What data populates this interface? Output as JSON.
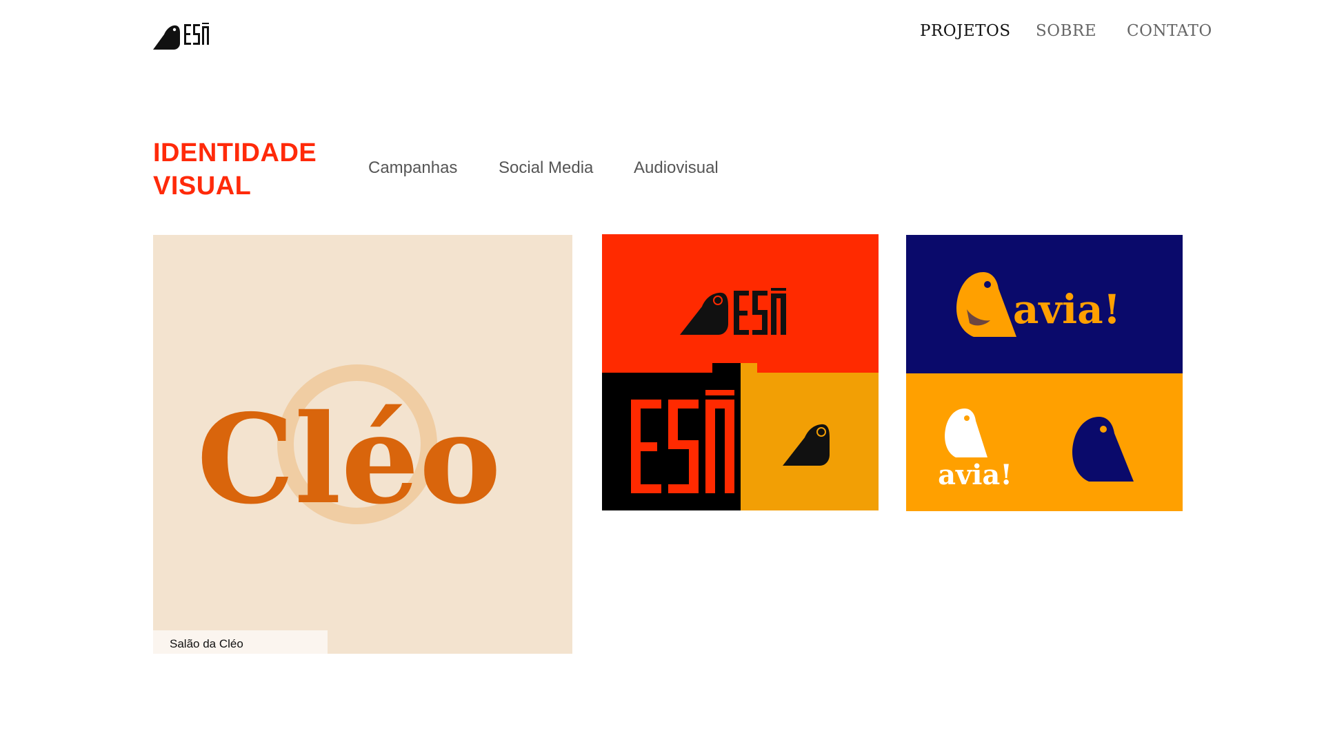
{
  "header": {
    "logo_icon": "bird-logo-icon",
    "nav": [
      {
        "label": "PROJETOS",
        "active": true
      },
      {
        "label": "SOBRE",
        "active": false
      },
      {
        "label": "CONTATO",
        "active": false
      }
    ]
  },
  "category": {
    "title": "IDENTIDADE VISUAL",
    "tabs": [
      "Campanhas",
      "Social Media",
      "Audiovisual"
    ]
  },
  "projects": [
    {
      "wordmark": "Cléo",
      "caption": "Salão da Cléo"
    },
    {
      "wordmark": "ESŪ"
    },
    {
      "wordmark": "avia!"
    }
  ],
  "colors": {
    "accent_red": "#ff2a0a",
    "cleo_bg": "#f3e3cf",
    "cleo_orange": "#d9650c",
    "esu_red": "#ff2a00",
    "esu_orange": "#f29f05",
    "avia_navy": "#0a0a6b",
    "avia_orange": "#ffa000"
  }
}
